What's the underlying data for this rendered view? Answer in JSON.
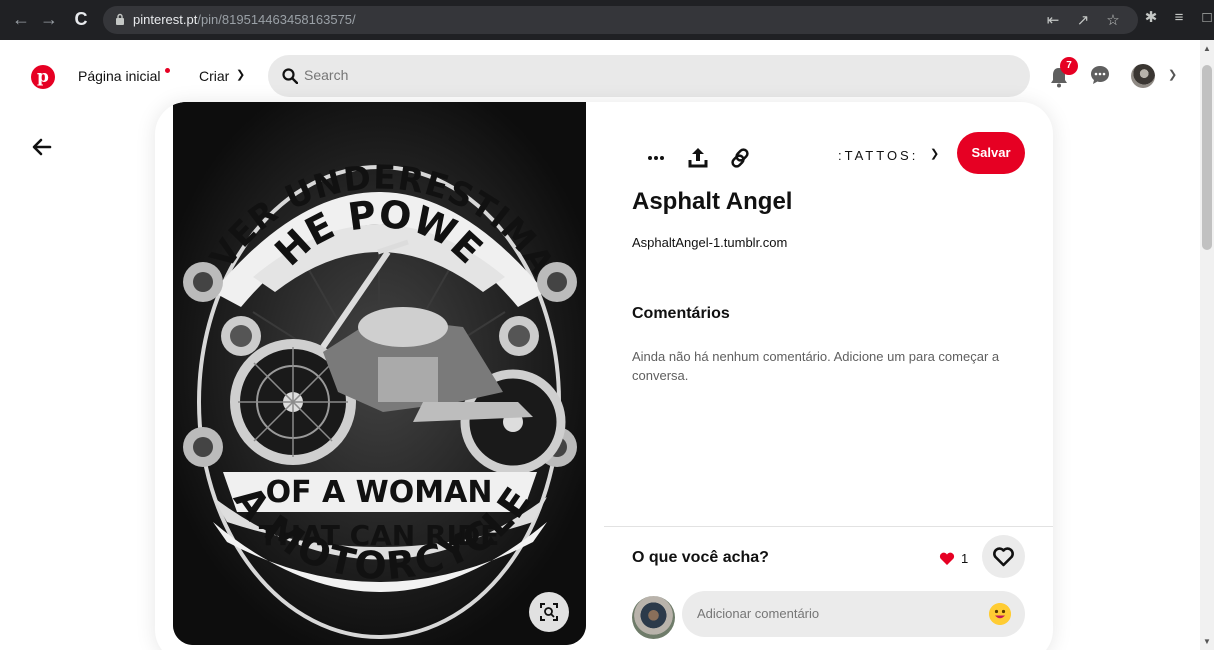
{
  "browser": {
    "url_host": "pinterest.pt",
    "url_path": "/pin/819514463458163575/"
  },
  "header": {
    "home_label": "Página inicial",
    "create_label": "Criar",
    "search_placeholder": "Search",
    "notification_count": "7"
  },
  "pin": {
    "board_name": ":TATTOS:",
    "save_label": "Salvar",
    "title": "Asphalt Angel",
    "source": "AsphaltAngel-1.tumblr.com",
    "image_text": {
      "line1": "NEVER UNDERESTIMATE",
      "line2": "THE POWER",
      "line3": "OF A WOMAN",
      "line4": "THAT CAN RIDE",
      "line5": "A MOTORCYCLE"
    }
  },
  "comments": {
    "heading": "Comentários",
    "empty_text": "Ainda não há nenhum comentário. Adicione um para começar a conversa.",
    "feedback_question": "O que você acha?",
    "reaction_count": "1",
    "input_placeholder": "Adicionar comentário"
  },
  "colors": {
    "brand_red": "#e60023",
    "input_bg": "#ebebeb"
  }
}
